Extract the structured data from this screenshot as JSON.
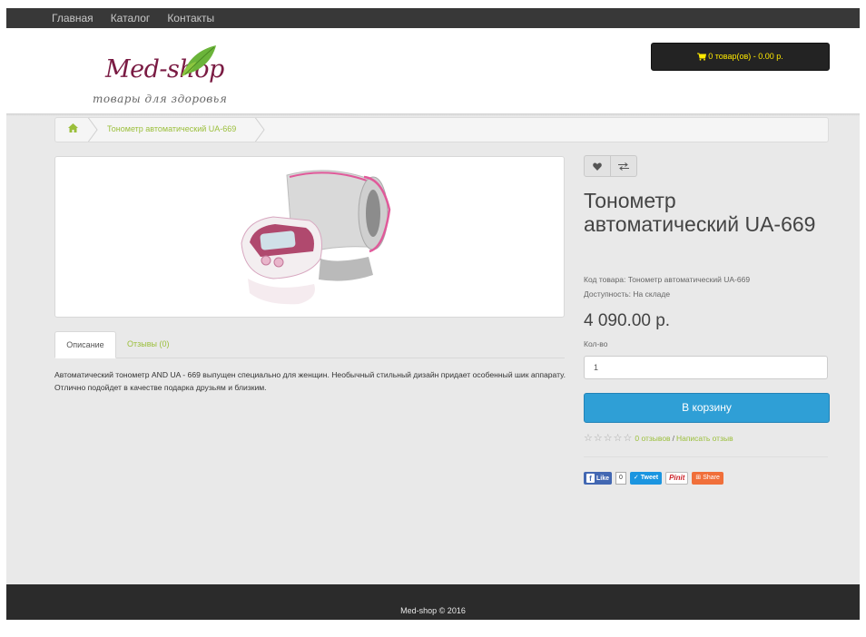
{
  "nav": {
    "items": [
      "Главная",
      "Каталог",
      "Контакты"
    ]
  },
  "logo": {
    "title": "Med-shop",
    "subtitle": "товары для здоровья"
  },
  "cart": {
    "label": "0 товар(ов) - 0.00 р.",
    "icon": "cart-icon"
  },
  "breadcrumb": {
    "home_icon": "home-icon",
    "current": "Тонометр автоматический UA-669"
  },
  "product": {
    "title": "Тонометр автоматический UA-669",
    "code_label": "Код товара:",
    "code_value": "Тонометр автоматический UA-669",
    "availability_label": "Доступность:",
    "availability_value": "На складе",
    "price": "4 090.00 р.",
    "qty_label": "Кол-во",
    "qty_value": "1",
    "add_to_cart": "В корзину",
    "rating_value": 0,
    "reviews_link": "0 отзывов",
    "rating_separator": "/",
    "write_review": "Написать отзыв"
  },
  "tabs": [
    {
      "label": "Описание",
      "active": true
    },
    {
      "label": "Отзывы (0)",
      "active": false
    }
  ],
  "description": "Автоматический тонометр AND UA - 669 выпущен специально для женщин. Необычный стильный дизайн придает особенный шик аппарату. Отлично подойдет в качестве подарка друзьям и близким.",
  "share": {
    "fb_like": "Like",
    "fb_count": "0",
    "tweet": "Tweet",
    "pinit": "Pinit",
    "share": "Share"
  },
  "footer": {
    "text": "Med-shop © 2016"
  },
  "colors": {
    "accent_green": "#9bbf3b",
    "button_blue": "#2f9fd6",
    "cart_yellow": "#ffea00",
    "logo_burgundy": "#7a1b43"
  }
}
